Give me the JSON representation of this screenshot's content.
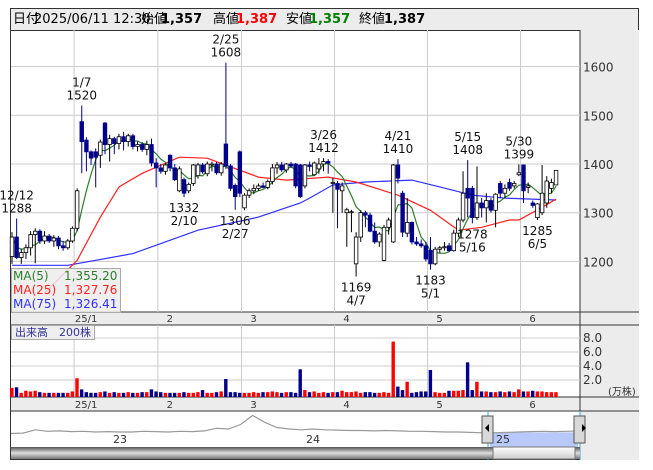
{
  "header": {
    "date_label": "日付",
    "date": "2025/06/11 12:30",
    "open_label": "始値",
    "open": "1,357",
    "high_label": "高値",
    "high": "1,387",
    "low_label": "安値",
    "low": "1,357",
    "close_label": "終値",
    "close": "1,387"
  },
  "legend": [
    {
      "label": "MA(5)",
      "value": "1,355.20",
      "color": "#2e7d2e"
    },
    {
      "label": "MA(25)",
      "value": "1,327.76",
      "color": "#ff2020"
    },
    {
      "label": "MA(75)",
      "value": "1,326.41",
      "color": "#3030ff"
    }
  ],
  "volume_panel": {
    "label": "出来高　200株",
    "unit": "(万株)",
    "ticks": [
      "8.0",
      "6.0",
      "4.0",
      "2.0"
    ]
  },
  "colors": {
    "up_fill": "#ffffff",
    "down_fill": "#00008b",
    "vol_up": "#ff0000",
    "vol_down": "#00008b",
    "vol_flat": "#888888",
    "ma5": "#2e7d2e",
    "ma25": "#ff2020",
    "ma75": "#3030ff",
    "high_text": "#ff0000",
    "low_text": "#008000"
  },
  "chart_data": {
    "type": "candlestick",
    "title": "",
    "ylim": [
      1093,
      1674
    ],
    "y_ticks": [
      "1600",
      "1500",
      "1400",
      "1300",
      "1200"
    ],
    "x_ticks": [
      {
        "label": "25/1",
        "index": 14
      },
      {
        "label": "2",
        "index": 32
      },
      {
        "label": "3",
        "index": 50
      },
      {
        "label": "4",
        "index": 70
      },
      {
        "label": "5",
        "index": 90
      },
      {
        "label": "6",
        "index": 110
      }
    ],
    "ohlc": [
      [
        1210,
        1260,
        1195,
        1250
      ],
      [
        1250,
        1288,
        1205,
        1208
      ],
      [
        1208,
        1225,
        1195,
        1218
      ],
      [
        1218,
        1235,
        1205,
        1228
      ],
      [
        1228,
        1262,
        1212,
        1255
      ],
      [
        1255,
        1268,
        1196,
        1262
      ],
      [
        1262,
        1266,
        1236,
        1242
      ],
      [
        1242,
        1262,
        1236,
        1252
      ],
      [
        1252,
        1256,
        1238,
        1242
      ],
      [
        1242,
        1254,
        1230,
        1248
      ],
      [
        1248,
        1252,
        1225,
        1232
      ],
      [
        1232,
        1242,
        1222,
        1228
      ],
      [
        1228,
        1246,
        1224,
        1242
      ],
      [
        1242,
        1272,
        1238,
        1268
      ],
      [
        1268,
        1350,
        1262,
        1345
      ],
      [
        1487,
        1520,
        1381,
        1446
      ],
      [
        1449,
        1455,
        1385,
        1425
      ],
      [
        1425,
        1428,
        1398,
        1412
      ],
      [
        1425,
        1432,
        1352,
        1414
      ],
      [
        1418,
        1450,
        1392,
        1445
      ],
      [
        1484,
        1486,
        1420,
        1440
      ],
      [
        1440,
        1460,
        1405,
        1452
      ],
      [
        1452,
        1456,
        1420,
        1442
      ],
      [
        1442,
        1462,
        1430,
        1456
      ],
      [
        1456,
        1466,
        1428,
        1446
      ],
      [
        1446,
        1462,
        1436,
        1458
      ],
      [
        1458,
        1462,
        1430,
        1436
      ],
      [
        1436,
        1446,
        1426,
        1440
      ],
      [
        1440,
        1445,
        1425,
        1430
      ],
      [
        1430,
        1448,
        1418,
        1440
      ],
      [
        1440,
        1452,
        1395,
        1402
      ],
      [
        1402,
        1412,
        1352,
        1392
      ],
      [
        1392,
        1400,
        1380,
        1385
      ],
      [
        1385,
        1402,
        1378,
        1398
      ],
      [
        1418,
        1420,
        1385,
        1392
      ],
      [
        1392,
        1400,
        1365,
        1368
      ],
      [
        1345,
        1395,
        1342,
        1390
      ],
      [
        1368,
        1372,
        1332,
        1340
      ],
      [
        1345,
        1362,
        1340,
        1358
      ],
      [
        1360,
        1400,
        1355,
        1398
      ],
      [
        1376,
        1402,
        1370,
        1398
      ],
      [
        1398,
        1402,
        1380,
        1384
      ],
      [
        1380,
        1405,
        1375,
        1400
      ],
      [
        1398,
        1405,
        1385,
        1400
      ],
      [
        1400,
        1404,
        1378,
        1382
      ],
      [
        1382,
        1404,
        1376,
        1400
      ],
      [
        1441,
        1608,
        1390,
        1396
      ],
      [
        1396,
        1400,
        1345,
        1350
      ],
      [
        1356,
        1360,
        1306,
        1333
      ],
      [
        1425,
        1428,
        1332,
        1340
      ],
      [
        1310,
        1340,
        1305,
        1336
      ],
      [
        1336,
        1350,
        1330,
        1345
      ],
      [
        1345,
        1358,
        1338,
        1350
      ],
      [
        1350,
        1360,
        1345,
        1355
      ],
      [
        1355,
        1362,
        1350,
        1352
      ],
      [
        1352,
        1368,
        1348,
        1364
      ],
      [
        1364,
        1400,
        1358,
        1392
      ],
      [
        1392,
        1404,
        1380,
        1398
      ],
      [
        1398,
        1404,
        1384,
        1388
      ],
      [
        1388,
        1402,
        1382,
        1400
      ],
      [
        1400,
        1404,
        1392,
        1396
      ],
      [
        1400,
        1402,
        1350,
        1355
      ],
      [
        1398,
        1400,
        1330,
        1333
      ],
      [
        1355,
        1400,
        1350,
        1398
      ],
      [
        1398,
        1405,
        1385,
        1395
      ],
      [
        1378,
        1405,
        1375,
        1402
      ],
      [
        1390,
        1412,
        1380,
        1400
      ],
      [
        1400,
        1412,
        1385,
        1405
      ],
      [
        1405,
        1410,
        1380,
        1402
      ],
      [
        1360,
        1372,
        1300,
        1362
      ],
      [
        1360,
        1365,
        1268,
        1348
      ],
      [
        1345,
        1362,
        1300,
        1355
      ],
      [
        1300,
        1310,
        1230,
        1306
      ],
      [
        1300,
        1306,
        1260,
        1302
      ],
      [
        1195,
        1260,
        1169,
        1250
      ],
      [
        1250,
        1305,
        1240,
        1300
      ],
      [
        1300,
        1304,
        1270,
        1295
      ],
      [
        1295,
        1300,
        1260,
        1262
      ],
      [
        1262,
        1280,
        1236,
        1240
      ],
      [
        1240,
        1260,
        1230,
        1256
      ],
      [
        1202,
        1275,
        1200,
        1270
      ],
      [
        1270,
        1290,
        1255,
        1285
      ],
      [
        1240,
        1400,
        1238,
        1398
      ],
      [
        1398,
        1410,
        1360,
        1371
      ],
      [
        1340,
        1345,
        1250,
        1260
      ],
      [
        1258,
        1330,
        1250,
        1280
      ],
      [
        1280,
        1282,
        1235,
        1240
      ],
      [
        1240,
        1250,
        1232,
        1236
      ],
      [
        1236,
        1245,
        1228,
        1232
      ],
      [
        1232,
        1240,
        1200,
        1205
      ],
      [
        1223,
        1250,
        1183,
        1195
      ],
      [
        1195,
        1230,
        1192,
        1225
      ],
      [
        1225,
        1232,
        1218,
        1228
      ],
      [
        1228,
        1240,
        1222,
        1230
      ],
      [
        1232,
        1238,
        1220,
        1222
      ],
      [
        1222,
        1265,
        1220,
        1258
      ],
      [
        1258,
        1290,
        1250,
        1285
      ],
      [
        1285,
        1385,
        1280,
        1340
      ],
      [
        1350,
        1408,
        1290,
        1330
      ],
      [
        1350,
        1355,
        1278,
        1290
      ],
      [
        1290,
        1395,
        1285,
        1320
      ],
      [
        1320,
        1330,
        1290,
        1310
      ],
      [
        1310,
        1340,
        1280,
        1325
      ],
      [
        1325,
        1330,
        1300,
        1305
      ],
      [
        1305,
        1340,
        1270,
        1338
      ],
      [
        1360,
        1365,
        1330,
        1340
      ],
      [
        1340,
        1358,
        1330,
        1350
      ],
      [
        1362,
        1370,
        1345,
        1350
      ],
      [
        1355,
        1365,
        1350,
        1360
      ],
      [
        1378,
        1399,
        1375,
        1382
      ],
      [
        1398,
        1399,
        1320,
        1345
      ],
      [
        1352,
        1362,
        1340,
        1355
      ],
      [
        1320,
        1325,
        1310,
        1315
      ],
      [
        1290,
        1320,
        1285,
        1318
      ],
      [
        1300,
        1398,
        1295,
        1340
      ],
      [
        1320,
        1375,
        1310,
        1365
      ],
      [
        1350,
        1370,
        1340,
        1362
      ],
      [
        1357,
        1387,
        1357,
        1387
      ]
    ],
    "volume": [
      1.3,
      1.4,
      0.6,
      0.9,
      0.8,
      0.9,
      0.7,
      0.6,
      0.6,
      0.6,
      0.6,
      0.6,
      0.6,
      0.8,
      2.7,
      1.1,
      0.7,
      0.6,
      0.6,
      0.7,
      0.8,
      0.6,
      0.7,
      0.6,
      0.6,
      0.7,
      0.6,
      0.6,
      0.7,
      0.7,
      1.1,
      0.8,
      0.7,
      0.6,
      0.6,
      0.6,
      0.6,
      0.7,
      0.6,
      0.6,
      0.7,
      1.0,
      0.6,
      0.6,
      0.7,
      0.8,
      2.6,
      0.7,
      0.7,
      0.6,
      0.6,
      0.6,
      0.7,
      0.6,
      0.7,
      0.7,
      0.8,
      0.7,
      0.6,
      0.7,
      0.7,
      0.6,
      4.0,
      1.0,
      0.7,
      0.8,
      0.6,
      0.7,
      0.6,
      0.7,
      0.7,
      0.9,
      0.7,
      0.7,
      0.8,
      0.6,
      0.7,
      0.7,
      0.6,
      0.6,
      0.7,
      0.6,
      8.0,
      1.5,
      1.0,
      2.2,
      0.6,
      0.7,
      0.8,
      0.8,
      3.9,
      0.7,
      0.6,
      0.6,
      0.9,
      0.9,
      0.9,
      1.0,
      5.0,
      1.0,
      2.2,
      0.8,
      0.8,
      0.7,
      0.7,
      0.8,
      0.7,
      0.8,
      0.7,
      1.1,
      0.8,
      0.8,
      0.9,
      0.8,
      0.8,
      0.7,
      0.7,
      0.7
    ],
    "ma_keypoints": {
      "ma25": [
        [
          7,
          1135
        ],
        [
          14,
          1202
        ],
        [
          19,
          1291
        ],
        [
          23,
          1353
        ],
        [
          28,
          1381
        ],
        [
          36,
          1414
        ],
        [
          42,
          1412
        ],
        [
          47,
          1394
        ],
        [
          53,
          1373
        ],
        [
          59,
          1367
        ],
        [
          68,
          1373
        ],
        [
          74,
          1363
        ],
        [
          83,
          1336
        ],
        [
          90,
          1305
        ],
        [
          96,
          1264
        ],
        [
          101,
          1270
        ],
        [
          107,
          1285
        ],
        [
          109,
          1285
        ],
        [
          114,
          1311
        ],
        [
          117,
          1328
        ]
      ],
      "ma75": [
        [
          0,
          1192
        ],
        [
          12,
          1192
        ],
        [
          26,
          1216
        ],
        [
          40,
          1264
        ],
        [
          53,
          1291
        ],
        [
          62,
          1320
        ],
        [
          64,
          1330
        ],
        [
          69,
          1357
        ],
        [
          76,
          1363
        ],
        [
          86,
          1367
        ],
        [
          92,
          1353
        ],
        [
          99,
          1336
        ],
        [
          106,
          1330
        ],
        [
          117,
          1326
        ]
      ]
    },
    "annotations": [
      {
        "index": 1,
        "date": "12/12",
        "price": "1288",
        "pos": "above"
      },
      {
        "index": 15,
        "date": "1/7",
        "price": "1520",
        "pos": "above"
      },
      {
        "index": 46,
        "date": "2/25",
        "price": "1608",
        "pos": "above"
      },
      {
        "index": 67,
        "date": "3/26",
        "price": "1412",
        "pos": "above"
      },
      {
        "index": 83,
        "date": "4/21",
        "price": "1410",
        "pos": "above"
      },
      {
        "index": 98,
        "date": "5/15",
        "price": "1408",
        "pos": "above"
      },
      {
        "index": 109,
        "date": "5/30",
        "price": "1399",
        "pos": "above"
      },
      {
        "index": 37,
        "date": "2/10",
        "price": "1332",
        "pos": "below"
      },
      {
        "index": 48,
        "date": "2/27",
        "price": "1306",
        "pos": "below"
      },
      {
        "index": 74,
        "date": "4/7",
        "price": "1169",
        "pos": "below"
      },
      {
        "index": 90,
        "date": "5/1",
        "price": "1183",
        "pos": "below"
      },
      {
        "index": 99,
        "date": "5/16",
        "price": "1278",
        "pos": "below"
      },
      {
        "index": 113,
        "date": "6/5",
        "price": "1285",
        "pos": "below"
      }
    ],
    "navigator": {
      "year_labels": [
        "23",
        "24",
        "25"
      ],
      "values": [
        1180,
        1185,
        1230,
        1210,
        1215,
        1205,
        1210,
        1200,
        1205,
        1200,
        1200,
        1210,
        1205,
        1200,
        1210,
        1205,
        1215,
        1250,
        1240,
        1300,
        1420,
        1330,
        1260,
        1240,
        1230,
        1240,
        1230,
        1225,
        1220,
        1220,
        1215,
        1220,
        1215,
        1210,
        1210,
        1205,
        1200,
        1200,
        1195,
        1190,
        1190,
        1195,
        1200,
        1205,
        1210,
        1205,
        1210,
        1215
      ]
    }
  }
}
